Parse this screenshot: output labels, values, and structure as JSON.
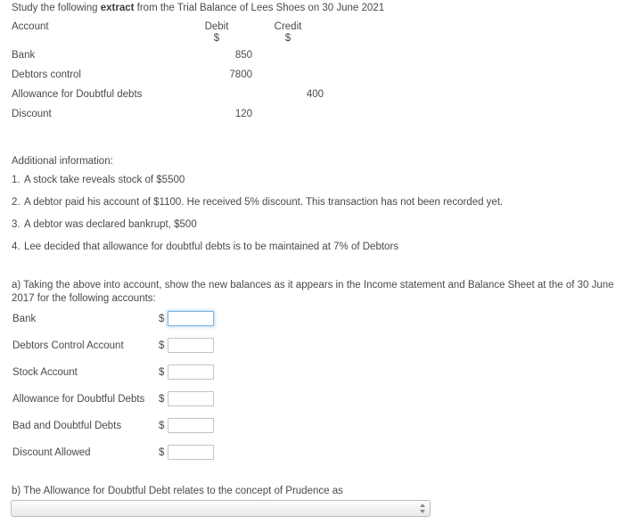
{
  "intro": {
    "before_bold": "Study the following ",
    "bold": "extract",
    "after_bold": " from the Trial Balance of Lees Shoes on 30 June 2021"
  },
  "trial_balance": {
    "headers": {
      "account": "Account",
      "debit": "Debit",
      "credit": "Credit"
    },
    "currency_row": {
      "account": "",
      "debit": "$",
      "credit": "$"
    },
    "rows": [
      {
        "account": "Bank",
        "debit": "850",
        "credit": ""
      },
      {
        "account": "Debtors control",
        "debit": "7800",
        "credit": ""
      },
      {
        "account": "Allowance for Doubtful debts",
        "debit": "",
        "credit": "400"
      },
      {
        "account": "Discount",
        "debit": "120",
        "credit": ""
      }
    ]
  },
  "additional_information": {
    "title": "Additional information:",
    "items": [
      {
        "num": "1.",
        "text": "A stock take reveals stock of $5500"
      },
      {
        "num": "2.",
        "text": "A debtor paid his account of $1100.  He received 5% discount. This transaction has not been recorded yet."
      },
      {
        "num": "3.",
        "text": "A debtor was declared bankrupt, $500"
      },
      {
        "num": "4.",
        "text": "Lee decided that  allowance for doubtful debts is to be maintained at 7% of Debtors"
      }
    ]
  },
  "part_a": {
    "text": "a)  Taking the above into account, show the new balances as it appears in the Income statement and Balance Sheet at the of 30 June 2017 for the following accounts:",
    "currency_symbol": "$",
    "fields": [
      {
        "label": "Bank",
        "value": "",
        "focused": true
      },
      {
        "label": "Debtors Control Account",
        "value": "",
        "focused": false
      },
      {
        "label": "Stock Account",
        "value": "",
        "focused": false
      },
      {
        "label": "Allowance for Doubtful Debts",
        "value": "",
        "focused": false
      },
      {
        "label": "Bad and Doubtful Debts",
        "value": "",
        "focused": false
      },
      {
        "label": "Discount Allowed",
        "value": "",
        "focused": false
      }
    ]
  },
  "part_b": {
    "text": "b)  The Allowance for Doubtful Debt relates to the concept of Prudence as",
    "select_value": "",
    "select_options": [
      ""
    ]
  },
  "colors": {
    "text": "#4a4a4a",
    "focus_ring": "#7eb4e2",
    "input_border": "#c3c3c3",
    "background": "#ffffff"
  }
}
